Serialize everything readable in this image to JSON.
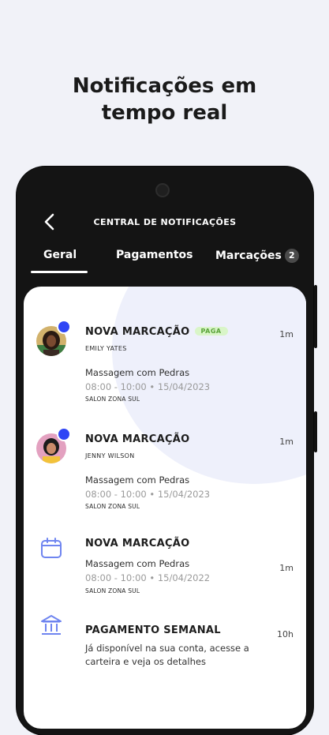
{
  "headline": {
    "line1": "Notificações em",
    "line2": "tempo real"
  },
  "app": {
    "title": "CENTRAL DE NOTIFICAÇÕES",
    "tabs": [
      {
        "label": "Geral",
        "active": true
      },
      {
        "label": "Pagamentos"
      },
      {
        "label": "Marcações",
        "badge": "2"
      }
    ]
  },
  "notifications": [
    {
      "title": "NOVA MARCAÇÃO",
      "badge": "PAGA",
      "client": "EMILY YATES",
      "service": "Massagem com Pedras",
      "schedule": "08:00 - 10:00  •  15/04/2023",
      "place": "SALON ZONA SUL",
      "time": "1m",
      "icon": "avatar",
      "unread": true
    },
    {
      "title": "NOVA MARCAÇÃO",
      "client": "JENNY WILSON",
      "service": "Massagem com Pedras",
      "schedule": "08:00 - 10:00  •  15/04/2023",
      "place": "SALON ZONA SUL",
      "time": "1m",
      "icon": "avatar",
      "unread": true
    },
    {
      "title": "NOVA MARCAÇÃO",
      "service": "Massagem com Pedras",
      "schedule": "08:00 - 10:00  •  15/04/2022",
      "place": "SALON ZONA SUL",
      "time": "1m",
      "icon": "calendar-icon"
    },
    {
      "title": "PAGAMENTO SEMANAL",
      "message": "Já disponível na sua conta, acesse a carteira e veja os detalhes",
      "time": "10h",
      "icon": "bank-icon"
    }
  ],
  "colors": {
    "accent": "#2f45f5",
    "paid_badge_bg": "#d9f5c8",
    "paid_badge_text": "#5aa33a"
  }
}
